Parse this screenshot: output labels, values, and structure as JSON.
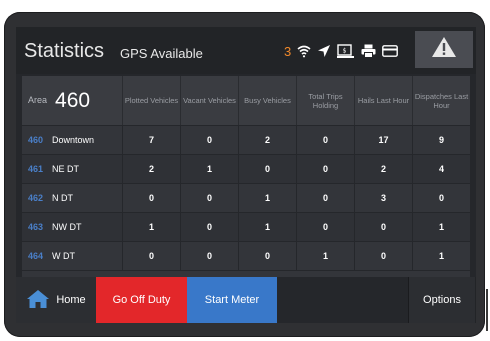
{
  "header": {
    "title": "Statistics",
    "gps_status": "GPS Available",
    "notification_count": "3",
    "icons": [
      "wifi-icon",
      "navigation-arrow-icon",
      "payment-terminal-icon",
      "printer-icon",
      "card-icon"
    ],
    "alert_icon": "warning-triangle-icon"
  },
  "table": {
    "area_label": "Area",
    "area_value": "460",
    "columns": [
      "Plotted Vehicles",
      "Vacant Vehicles",
      "Busy Vehicles",
      "Total Trips Holding",
      "Hails Last Hour",
      "Dispatches Last Hour"
    ],
    "rows": [
      {
        "code": "460",
        "name": "Downtown",
        "values": [
          "7",
          "0",
          "2",
          "0",
          "17",
          "9"
        ]
      },
      {
        "code": "461",
        "name": "NE DT",
        "values": [
          "2",
          "1",
          "0",
          "0",
          "2",
          "4"
        ]
      },
      {
        "code": "462",
        "name": "N DT",
        "values": [
          "0",
          "0",
          "1",
          "0",
          "3",
          "0"
        ]
      },
      {
        "code": "463",
        "name": "NW DT",
        "values": [
          "1",
          "0",
          "1",
          "0",
          "0",
          "1"
        ]
      },
      {
        "code": "464",
        "name": "W DT",
        "values": [
          "0",
          "0",
          "0",
          "1",
          "0",
          "1"
        ]
      }
    ]
  },
  "bottom_bar": {
    "home_label": "Home",
    "off_duty_label": "Go Off Duty",
    "start_meter_label": "Start Meter",
    "options_label": "Options"
  },
  "colors": {
    "accent_orange": "#f0892b",
    "area_code_blue": "#4a7fc8",
    "off_duty_red": "#e3272a",
    "start_meter_blue": "#3978c9"
  }
}
